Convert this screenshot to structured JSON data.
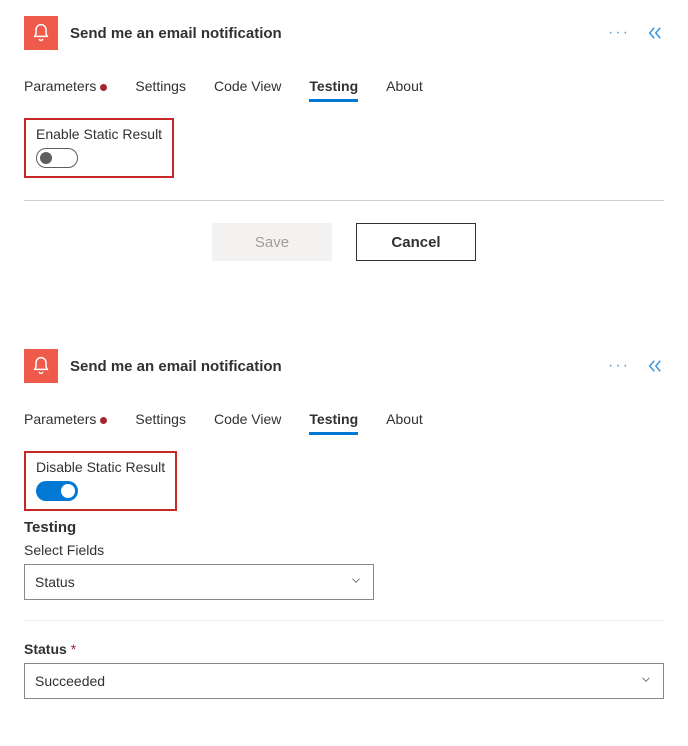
{
  "panel1": {
    "title": "Send me an email notification",
    "tabs": [
      "Parameters",
      "Settings",
      "Code View",
      "Testing",
      "About"
    ],
    "activeTab": "Testing",
    "paramDotTab": "Parameters",
    "toggleLabel": "Enable Static Result",
    "toggleState": "off",
    "saveLabel": "Save",
    "cancelLabel": "Cancel"
  },
  "panel2": {
    "title": "Send me an email notification",
    "tabs": [
      "Parameters",
      "Settings",
      "Code View",
      "Testing",
      "About"
    ],
    "activeTab": "Testing",
    "paramDotTab": "Parameters",
    "toggleLabel": "Disable Static Result",
    "toggleState": "on",
    "sectionHeading": "Testing",
    "selectFieldsLabel": "Select Fields",
    "selectFieldsValue": "Status",
    "statusLabel": "Status",
    "statusRequired": "*",
    "statusValue": "Succeeded"
  }
}
